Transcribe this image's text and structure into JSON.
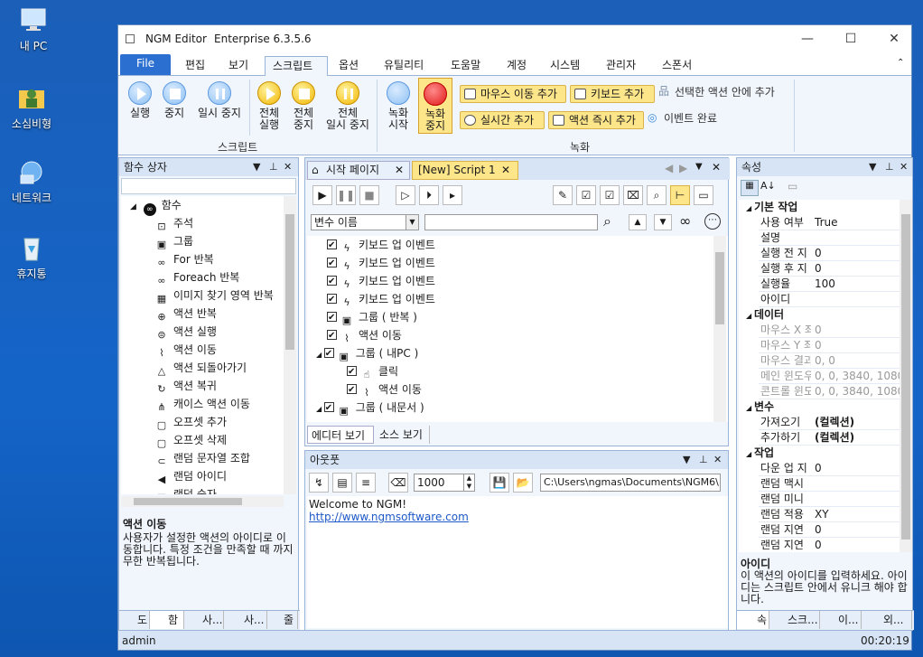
{
  "desktop": [
    {
      "label": "내 PC",
      "icon": "computer-icon"
    },
    {
      "label": "소심비형",
      "icon": "user-folder-icon"
    },
    {
      "label": "네트워크",
      "icon": "network-icon"
    },
    {
      "label": "휴지통",
      "icon": "recycle-bin-icon"
    }
  ],
  "window": {
    "title": "NGM Editor",
    "edition": "Enterprise 6.3.5.6"
  },
  "menu": [
    "File",
    "편집",
    "보기",
    "스크립트",
    "옵션",
    "유틸리티",
    "도움말",
    "계정",
    "시스템",
    "관리자",
    "스폰서"
  ],
  "ribbon": {
    "run": "실행",
    "stop": "중지",
    "pause": "일시 중지",
    "all_run_1": "전체",
    "all_run_2": "실행",
    "all_stop_1": "전체",
    "all_stop_2": "중지",
    "all_pause_1": "전체",
    "all_pause_2": "일시 중지",
    "group_script": "스크립트",
    "rec_start_1": "녹화",
    "rec_start_2": "시작",
    "rec_stop_1": "녹화",
    "rec_stop_2": "중지",
    "add_mouse_move": "마우스 이동 추가",
    "add_keyboard": "키보드 추가",
    "add_in_selected": "선택한 액션 안에 추가",
    "add_realtime": "실시간 추가",
    "add_action_now": "액션 즉시 추가",
    "event_done": "이벤트 완료",
    "group_record": "녹화"
  },
  "function_box": {
    "title": "함수 상자",
    "root": "함수",
    "items": [
      "주석",
      "그룹",
      "For 반복",
      "Foreach 반복",
      "이미지 찾기 영역 반복",
      "액션 반복",
      "액션 실행",
      "액션 이동",
      "액션 되돌아가기",
      "액션 복귀",
      "캐이스 액션 이동",
      "오프셋 추가",
      "오프셋 삭제",
      "랜덤 문자열 조합",
      "랜덤 아이디",
      "랜덤 숫자"
    ],
    "desc_title": "액션 이동",
    "desc_text": "사용자가 설정한 액션의 아이디로 이동합니다. 특정 조건을 만족할 때 까지 무한 반복됩니다.",
    "tabs": [
      "도",
      "함",
      "사...",
      "사...",
      "줄"
    ]
  },
  "editor": {
    "tab_start": "시작 페이지",
    "tab_script": "[New] Script 1",
    "var_name": "변수 이름",
    "lines": [
      {
        "text": "키보드 업 이벤트",
        "indent": 0
      },
      {
        "text": "키보드 업 이벤트",
        "indent": 0
      },
      {
        "text": "키보드 업 이벤트",
        "indent": 0
      },
      {
        "text": "키보드 업 이벤트",
        "indent": 0
      },
      {
        "text": "그룹 ( 반복 )",
        "indent": 0
      },
      {
        "text": "액션 이동",
        "indent": 0
      },
      {
        "text": "그룹 ( 내PC )",
        "indent": 0
      },
      {
        "text": "클릭",
        "indent": 1
      },
      {
        "text": "액션 이동",
        "indent": 1
      },
      {
        "text": "그룹 ( 내문서 )",
        "indent": 0
      }
    ],
    "bottom_tabs": [
      "에디터 보기",
      "소스 보기"
    ]
  },
  "output": {
    "title": "아웃풋",
    "count": "1000",
    "path": "C:\\Users\\ngmas\\Documents\\NGM6\\",
    "line1": "Welcome to NGM!",
    "line2": "http://www.ngmsoftware.com"
  },
  "properties": {
    "title": "속성",
    "sections": [
      {
        "name": "기본 작업",
        "rows": [
          [
            "사용 여부",
            "True"
          ],
          [
            "설명",
            ""
          ],
          [
            "실행 전 지",
            "0"
          ],
          [
            "실행 후 지",
            "0"
          ],
          [
            "실행율",
            "100"
          ],
          [
            "아이디",
            ""
          ]
        ]
      },
      {
        "name": "데이터",
        "rows": [
          [
            "마우스 X 좌",
            "0"
          ],
          [
            "마우스 Y 좌",
            "0"
          ],
          [
            "마우스 결과",
            "0, 0"
          ],
          [
            "메인 윈도우",
            "0, 0, 3840, 1080"
          ],
          [
            "콘트롤 윈도",
            "0, 0, 3840, 1080"
          ]
        ]
      },
      {
        "name": "변수",
        "rows": [
          [
            "가져오기",
            "(컬렉션)"
          ],
          [
            "추가하기",
            "(컬렉션)"
          ]
        ]
      },
      {
        "name": "작업",
        "rows": [
          [
            "다운 업 지",
            "0"
          ],
          [
            "랜덤 맥시",
            ""
          ],
          [
            "랜덤 미니",
            ""
          ],
          [
            "랜덤 적용",
            "XY"
          ],
          [
            "랜덤 지연",
            "0"
          ],
          [
            "랜덤 지연",
            "0"
          ]
        ]
      }
    ],
    "desc_title": "아이디",
    "desc_text": "이 액션의 아이디를 입력하세요. 아이디는 스크립트 안에서 유니크 해야 합니다.",
    "tabs": [
      "속",
      "스크...",
      "이...",
      "외..."
    ]
  },
  "status": {
    "user": "admin",
    "time": "00:20:19"
  }
}
